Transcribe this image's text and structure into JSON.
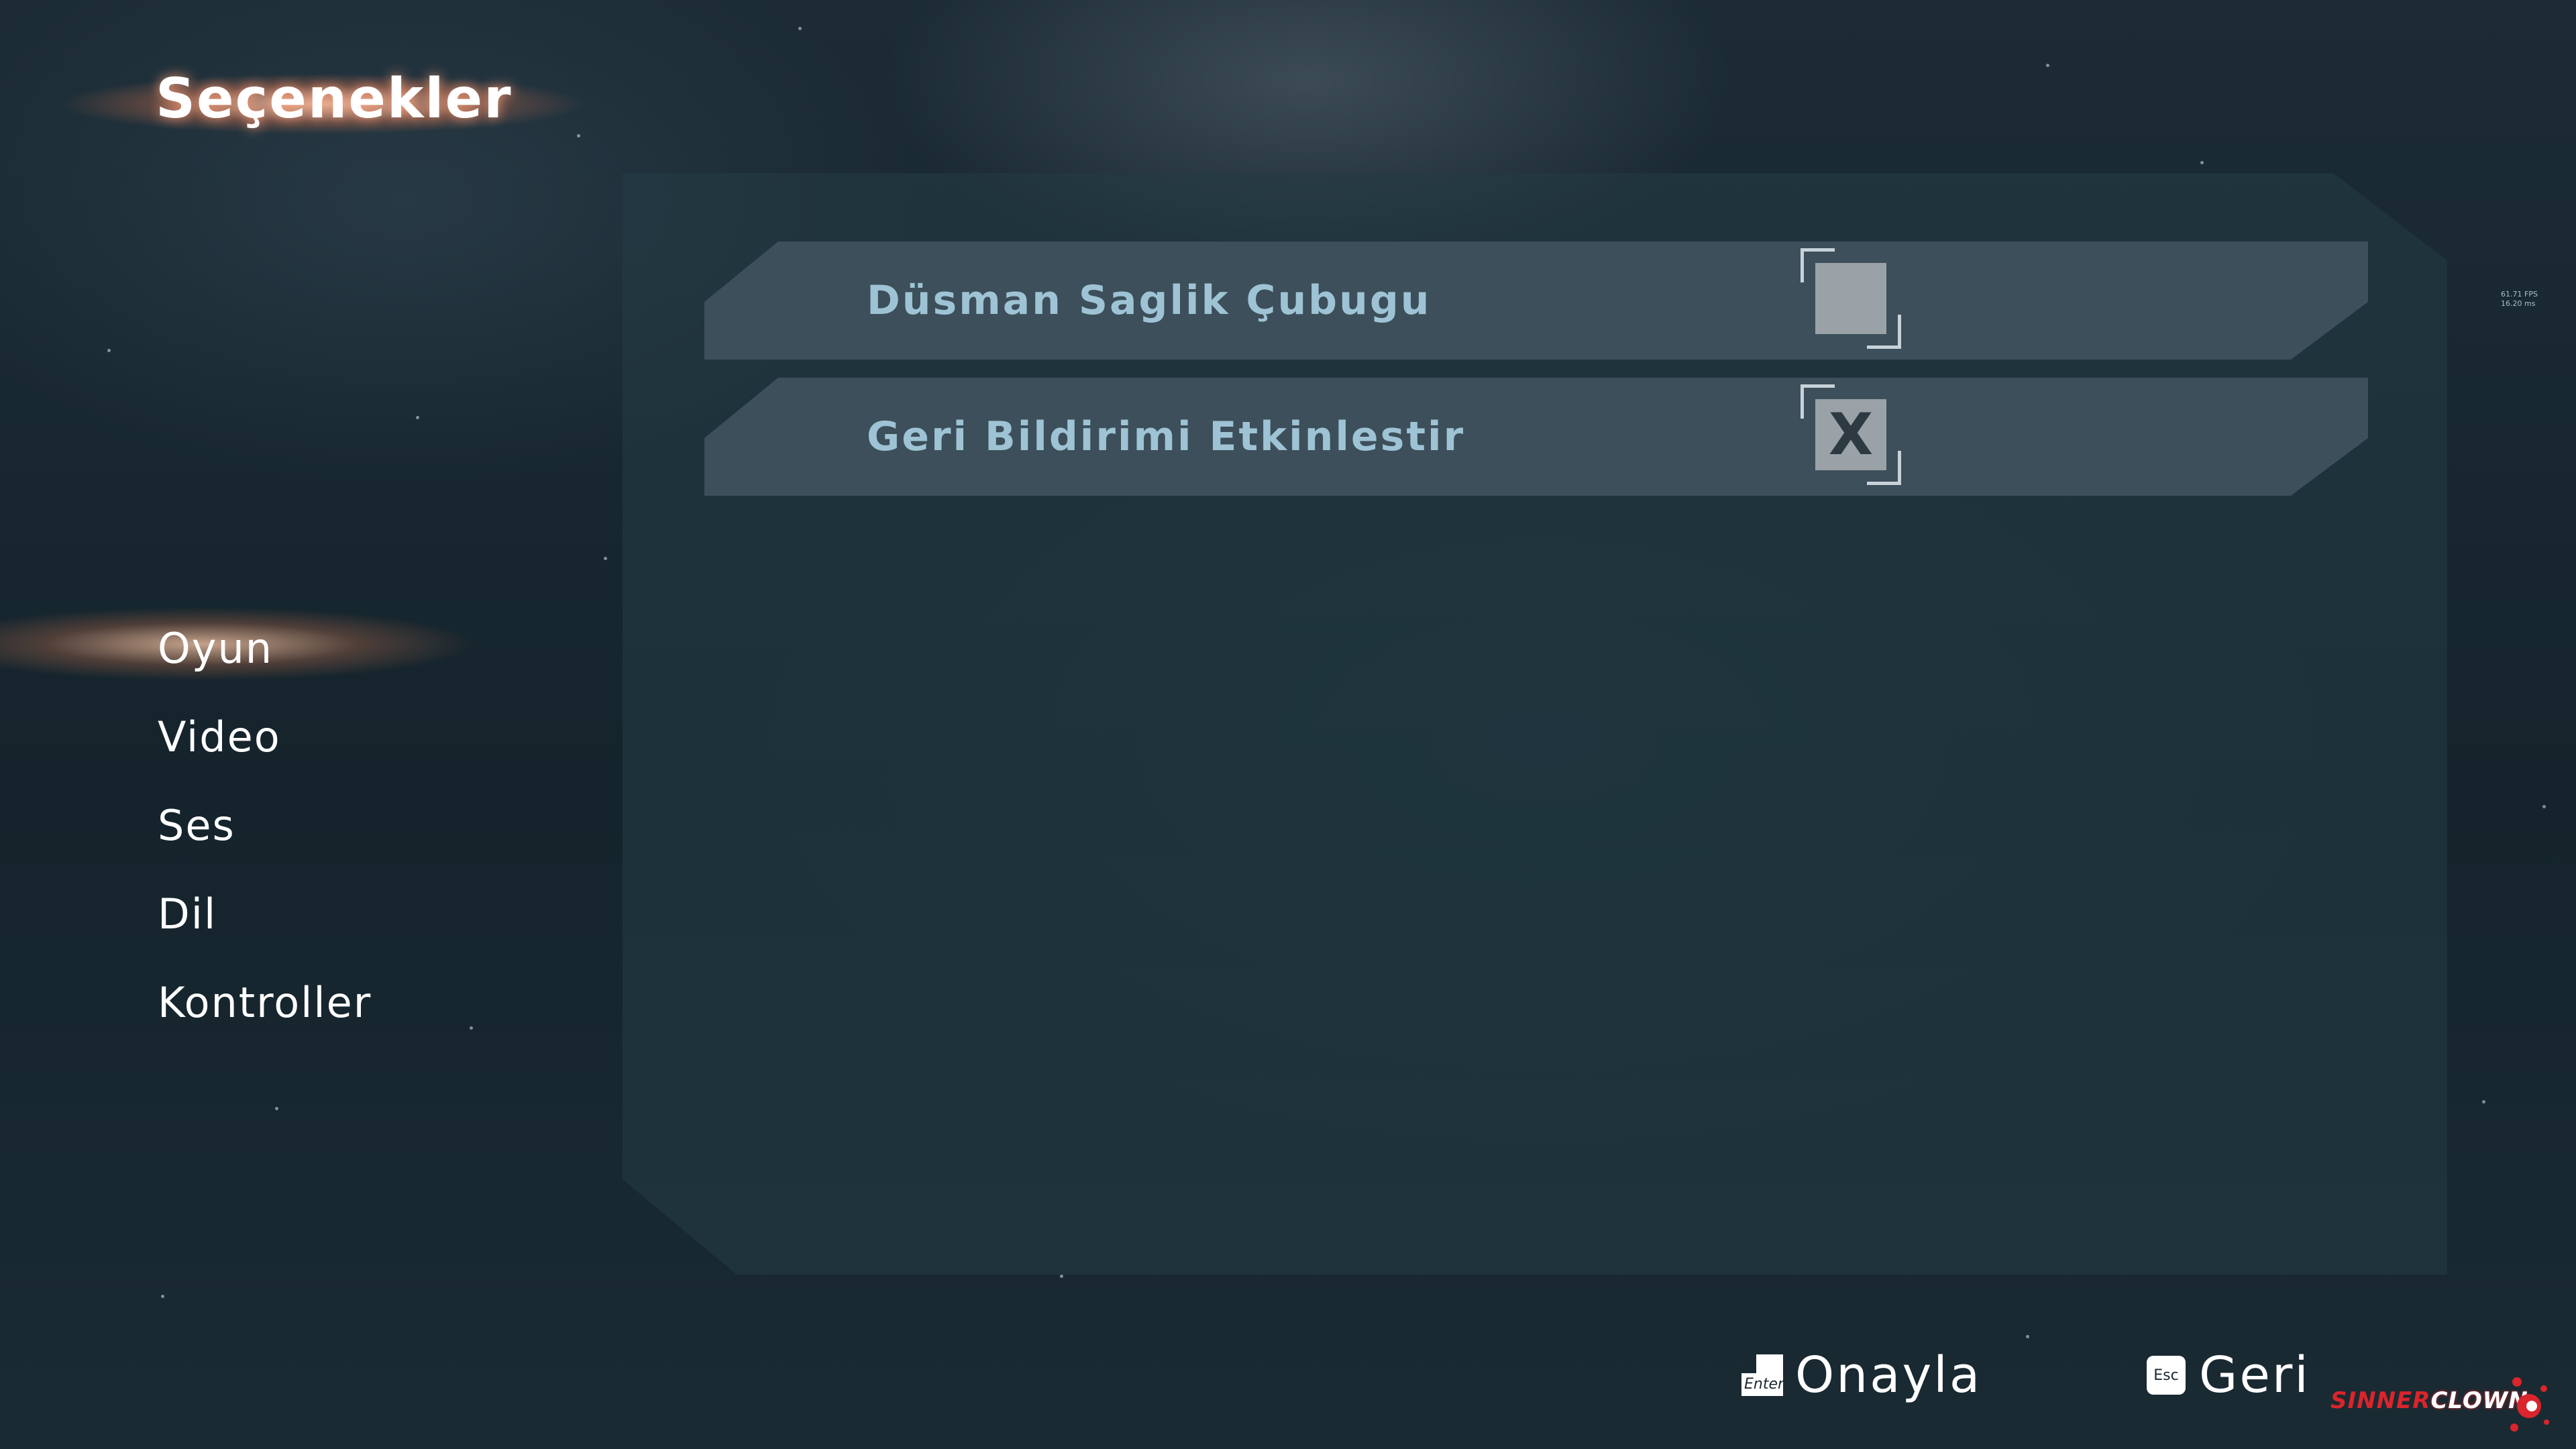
{
  "title": "Seçenekler",
  "sidebar": {
    "items": [
      {
        "label": "Oyun",
        "active": true
      },
      {
        "label": "Video",
        "active": false
      },
      {
        "label": "Ses",
        "active": false
      },
      {
        "label": "Dil",
        "active": false
      },
      {
        "label": "Kontroller",
        "active": false
      }
    ]
  },
  "options": [
    {
      "label": "Düsman Saglik Çubugu",
      "checked": false,
      "mark": ""
    },
    {
      "label": "Geri Bildirimi Etkinlestir",
      "checked": true,
      "mark": "X"
    }
  ],
  "fps": {
    "line1": "61.71 FPS",
    "line2": "16.20 ms"
  },
  "prompts": {
    "confirm": {
      "key": "Enter",
      "label": "Onayla"
    },
    "back": {
      "key": "Esc",
      "label": "Geri"
    }
  },
  "logo": {
    "part1": "SINNER",
    "part2": "CLOWN"
  },
  "colors": {
    "panel": "#3c4f5a",
    "option_text": "#9ec3d4",
    "checkbox_fill": "#9aa2a8",
    "glow": "#ffcdb0",
    "logo_red": "#d9252b"
  }
}
